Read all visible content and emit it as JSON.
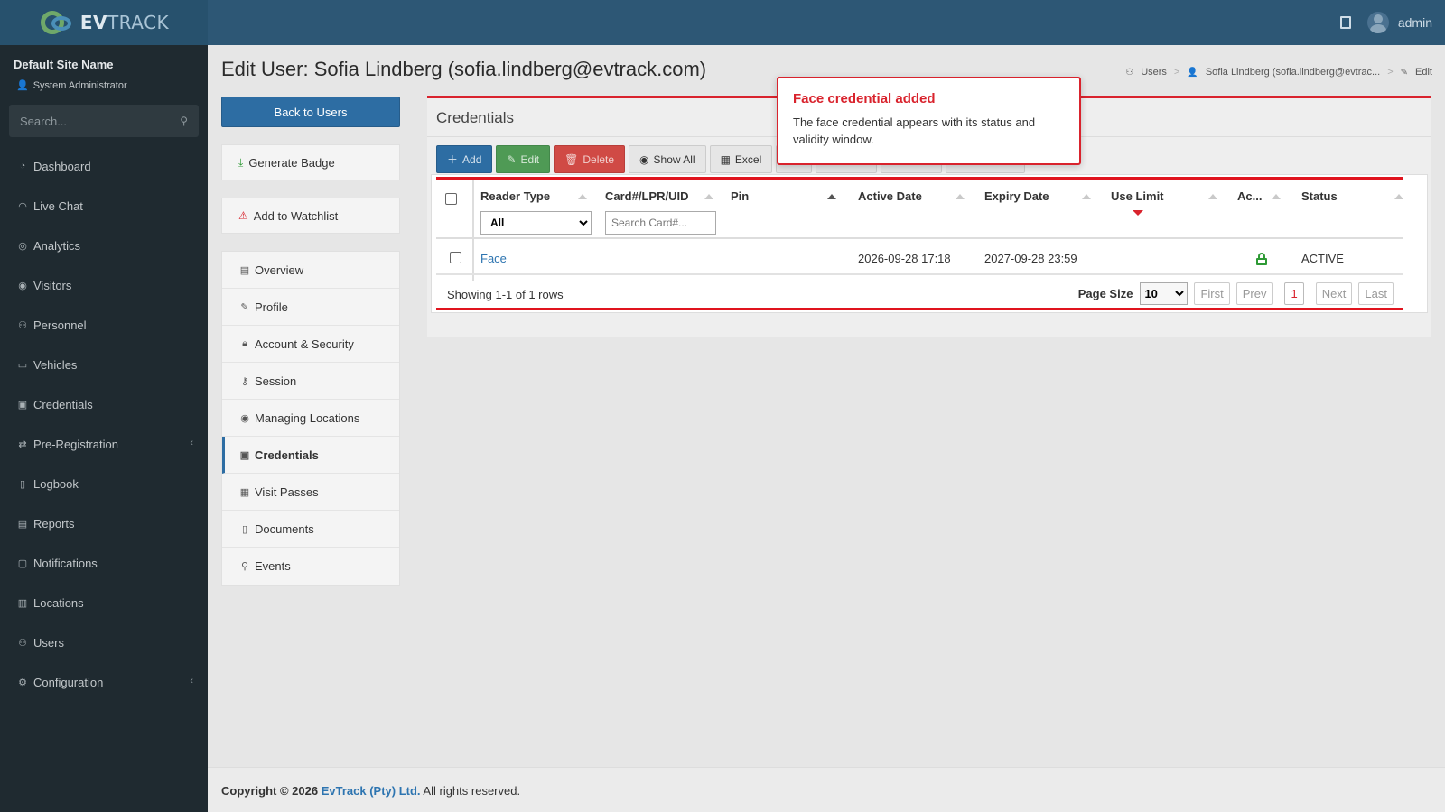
{
  "brand": {
    "logo_prefix": "EV",
    "logo_suffix": "TRACK"
  },
  "topbar": {
    "username": "admin"
  },
  "sidebar": {
    "site_name": "Default Site Name",
    "role": "System Administrator",
    "search_placeholder": "Search...",
    "items": [
      {
        "label": "Dashboard",
        "icon": "speedometer-icon"
      },
      {
        "label": "Live Chat",
        "icon": "headset-icon"
      },
      {
        "label": "Analytics",
        "icon": "target-icon"
      },
      {
        "label": "Visitors",
        "icon": "eye-icon"
      },
      {
        "label": "Personnel",
        "icon": "people-icon"
      },
      {
        "label": "Vehicles",
        "icon": "car-icon"
      },
      {
        "label": "Credentials",
        "icon": "id-card-icon"
      },
      {
        "label": "Pre-Registration",
        "icon": "swap-icon",
        "has_submenu": true
      },
      {
        "label": "Logbook",
        "icon": "book-icon"
      },
      {
        "label": "Reports",
        "icon": "chart-icon"
      },
      {
        "label": "Notifications",
        "icon": "chat-icon"
      },
      {
        "label": "Locations",
        "icon": "building-icon"
      },
      {
        "label": "Users",
        "icon": "users-icon"
      },
      {
        "label": "Configuration",
        "icon": "gear-icon",
        "has_submenu": true
      }
    ]
  },
  "page": {
    "title": "Edit User: Sofia Lindberg (sofia.lindberg@evtrack.com)",
    "breadcrumb": [
      "Users",
      "Sofia Lindberg (sofia.lindberg@evtrac...",
      "Edit"
    ]
  },
  "left": {
    "back_label": "Back to Users",
    "generate_badge": "Generate Badge",
    "add_watchlist": "Add to Watchlist",
    "menu": [
      {
        "label": "Overview",
        "icon": "list-icon"
      },
      {
        "label": "Profile",
        "icon": "pencil-icon"
      },
      {
        "label": "Account & Security",
        "icon": "lock-icon"
      },
      {
        "label": "Session",
        "icon": "key-icon"
      },
      {
        "label": "Managing Locations",
        "icon": "map-pin-icon"
      },
      {
        "label": "Credentials",
        "icon": "id-card-icon",
        "active": true
      },
      {
        "label": "Visit Passes",
        "icon": "calendar-icon"
      },
      {
        "label": "Documents",
        "icon": "document-icon"
      },
      {
        "label": "Events",
        "icon": "person-walking-icon"
      }
    ]
  },
  "panel": {
    "title": "Credentials",
    "toolbar": {
      "add": "Add",
      "edit": "Edit",
      "delete": "Delete",
      "show_all": "Show All",
      "excel": "Excel"
    }
  },
  "table": {
    "columns": [
      "Reader Type",
      "Card#/LPR/UID",
      "Pin",
      "Active Date",
      "Expiry Date",
      "Use Limit",
      "Ac...",
      "Status"
    ],
    "reader_filter_selected": "All",
    "card_search_placeholder": "Search Card#...",
    "rows": [
      {
        "reader_type": "Face",
        "card": "",
        "pin": "",
        "active_date": "2026-09-28 17:18",
        "expiry_date": "2027-09-28 23:59",
        "use_limit": "",
        "access": "unlock-icon",
        "status": "ACTIVE"
      }
    ],
    "showing": "Showing 1-1 of 1 rows",
    "page_size_label": "Page Size",
    "page_size": "10",
    "pager": {
      "first": "First",
      "prev": "Prev",
      "current": "1",
      "next": "Next",
      "last": "Last"
    }
  },
  "tooltip": {
    "title": "Face credential added",
    "body": "The face credential appears with its status and validity window."
  },
  "footer": {
    "prefix": "Copyright © 2026 ",
    "company": "EvTrack (Pty) Ltd.",
    "suffix": " All rights reserved."
  },
  "colors": {
    "accent_red": "#d9232d",
    "primary_blue": "#2d6da3",
    "success_green": "#4f9a55",
    "danger_red": "#d04a45",
    "topbar": "#2d5775",
    "sidebar": "#1f2a30"
  }
}
